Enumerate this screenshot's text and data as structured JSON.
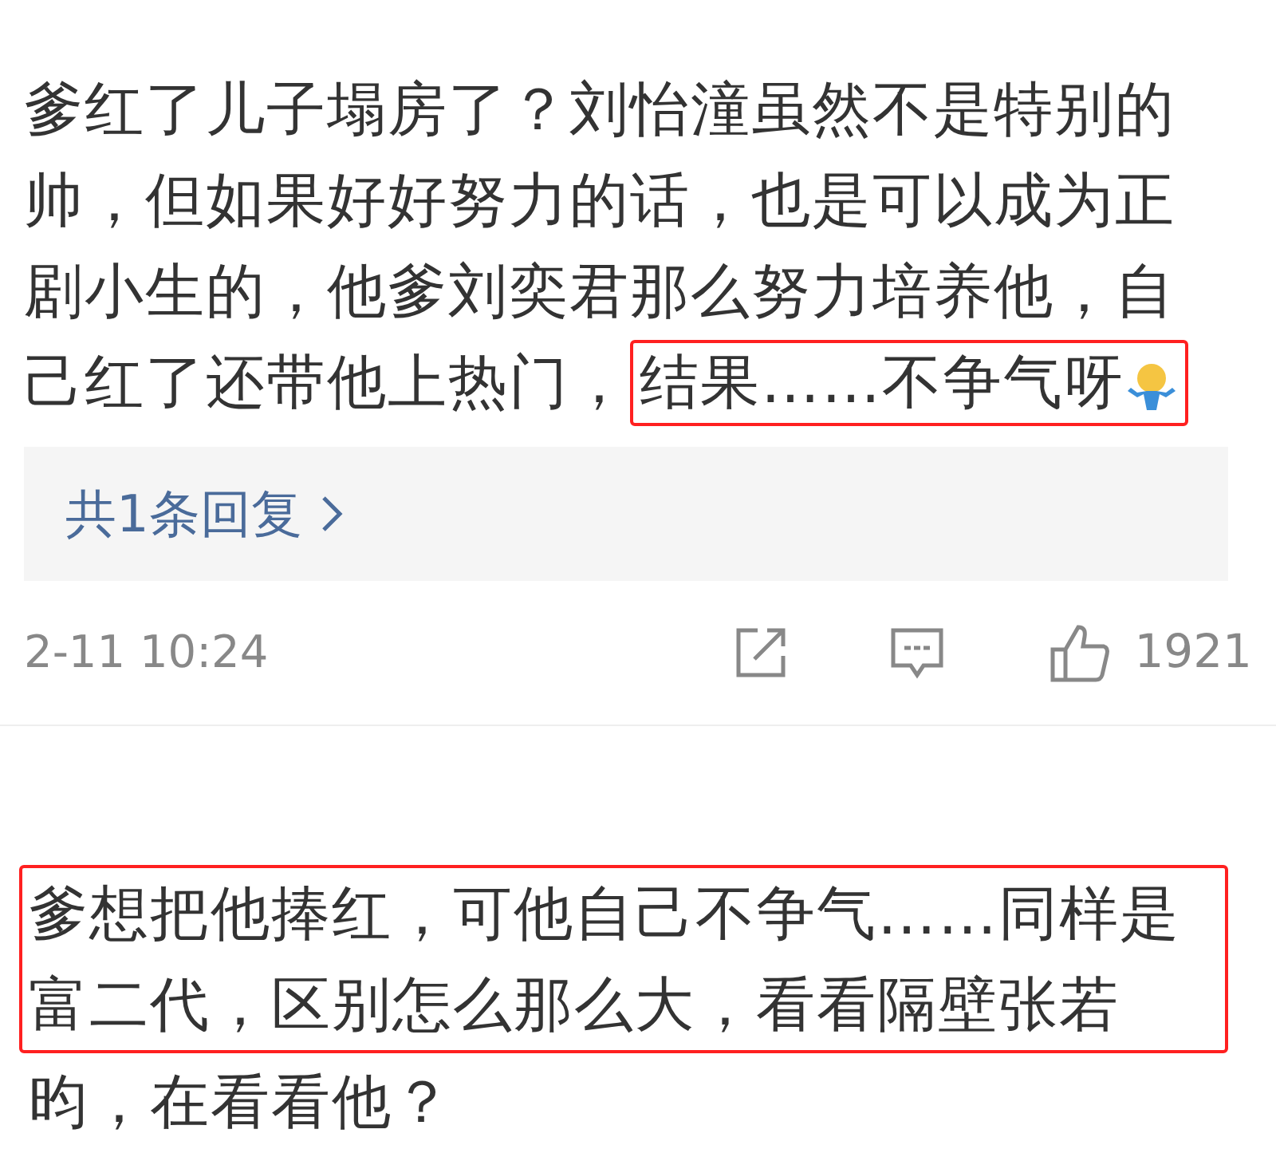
{
  "comment": {
    "lines": [
      "爹红了儿子塌房了？刘怡潼虽然不是特别的",
      "帅，但如果好好努力的话，也是可以成为正",
      "剧小生的，他爹刘奕君那么努力培养他，自",
      "己红了还带他上热门，"
    ],
    "highlight": {
      "text": "结果……不争气呀"
    },
    "replies": "共1条回复",
    "time": "2-11 10:24",
    "likes": "1921"
  },
  "next_comment": {
    "blocks": [
      {
        "lines": [
          "爹想把他捧红，可他自己不争气……同样是",
          "富二代，区别怎么那么大，看看隔壁张若"
        ],
        "highlighted": true
      },
      {
        "lines": [
          "昀，在看看他？"
        ],
        "highlighted": false
      }
    ]
  }
}
